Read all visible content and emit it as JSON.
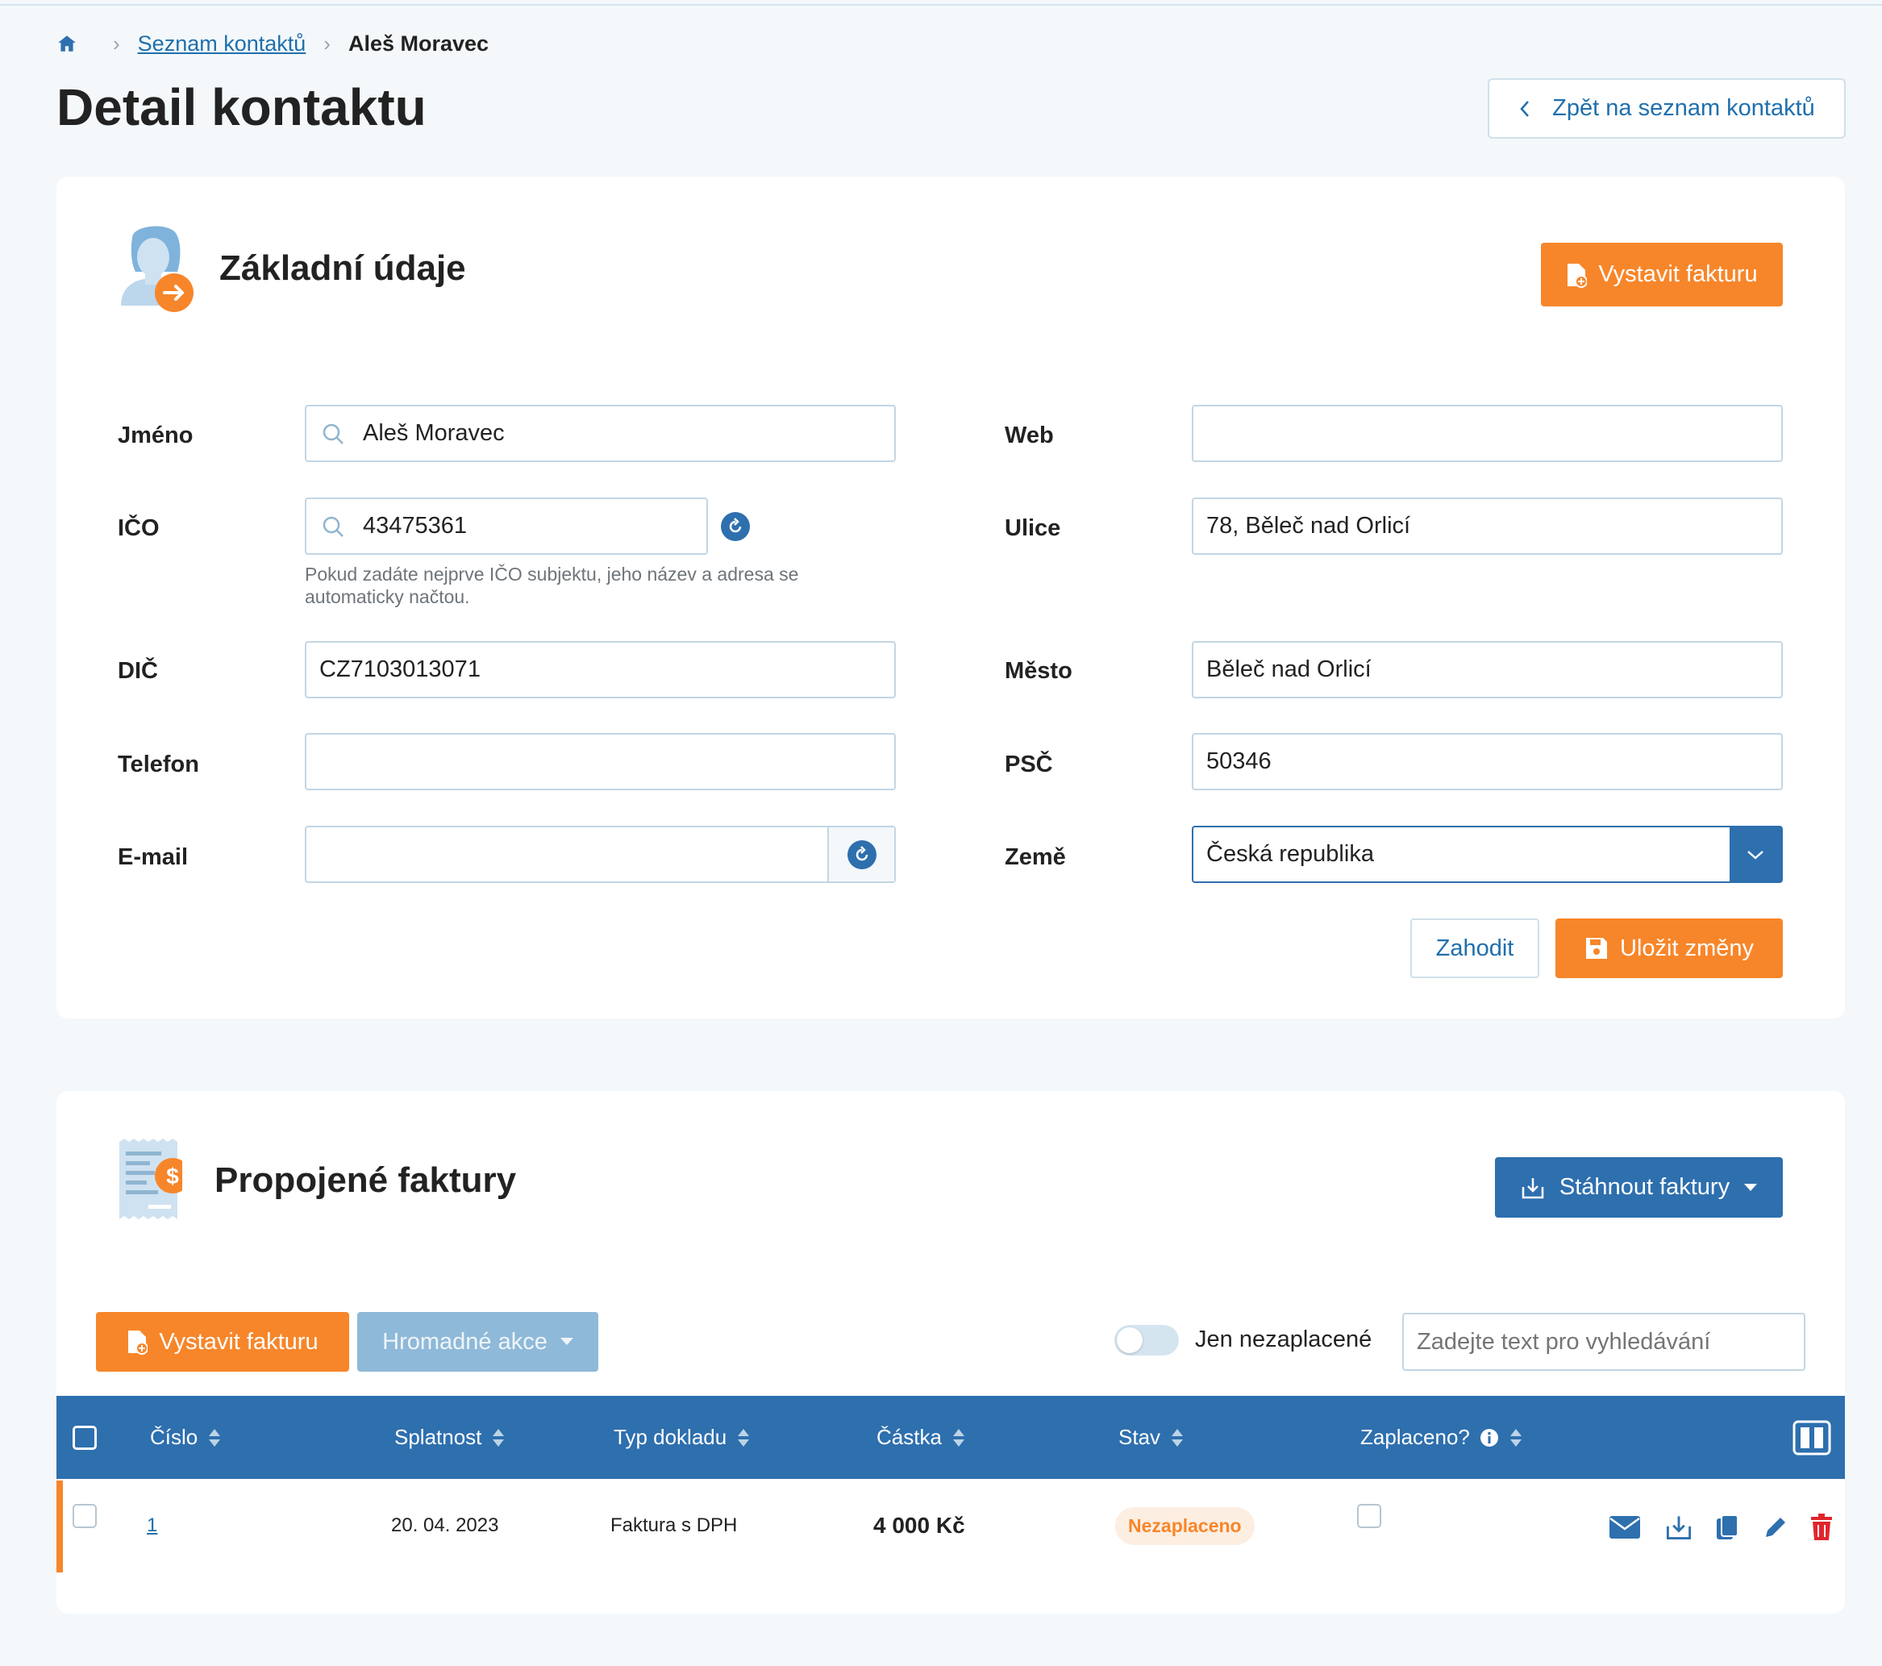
{
  "breadcrumb": {
    "list_label": "Seznam kontaktů",
    "current": "Aleš Moravec"
  },
  "page": {
    "title": "Detail kontaktu",
    "back_label": "Zpět na seznam kontaktů"
  },
  "basic": {
    "title": "Základní údaje",
    "issue_invoice_label": "Vystavit fakturu",
    "fields": {
      "jmeno_label": "Jméno",
      "jmeno_value": "Aleš Moravec",
      "ico_label": "IČO",
      "ico_value": "43475361",
      "ico_hint": "Pokud zadáte nejprve IČO subjektu, jeho název a adresa se automaticky načtou.",
      "dic_label": "DIČ",
      "dic_value": "CZ7103013071",
      "telefon_label": "Telefon",
      "telefon_value": "",
      "email_label": "E-mail",
      "email_value": "",
      "web_label": "Web",
      "web_value": "",
      "ulice_label": "Ulice",
      "ulice_value": "78, Běleč nad Orlicí",
      "mesto_label": "Město",
      "mesto_value": "Běleč nad Orlicí",
      "psc_label": "PSČ",
      "psc_value": "50346",
      "zeme_label": "Země",
      "zeme_value": "Česká republika"
    },
    "discard_label": "Zahodit",
    "save_label": "Uložit změny"
  },
  "invoices": {
    "title": "Propojené faktury",
    "download_label": "Stáhnout faktury",
    "issue_invoice_label": "Vystavit fakturu",
    "bulk_label": "Hromadné akce",
    "unpaid_only_label": "Jen nezaplacené",
    "search_placeholder": "Zadejte text pro vyhledávání",
    "columns": {
      "number": "Číslo",
      "due": "Splatnost",
      "doc_type": "Typ dokladu",
      "amount": "Částka",
      "status": "Stav",
      "paid": "Zaplaceno?"
    },
    "rows": [
      {
        "number": "1",
        "due": "20. 04. 2023",
        "doc_type": "Faktura s DPH",
        "amount": "4 000 Kč",
        "status": "Nezaplaceno"
      }
    ]
  },
  "colors": {
    "accent_orange": "#f7862a",
    "primary_blue": "#2e6fae",
    "link_blue": "#1f6fad",
    "delete_red": "#e0262d"
  }
}
